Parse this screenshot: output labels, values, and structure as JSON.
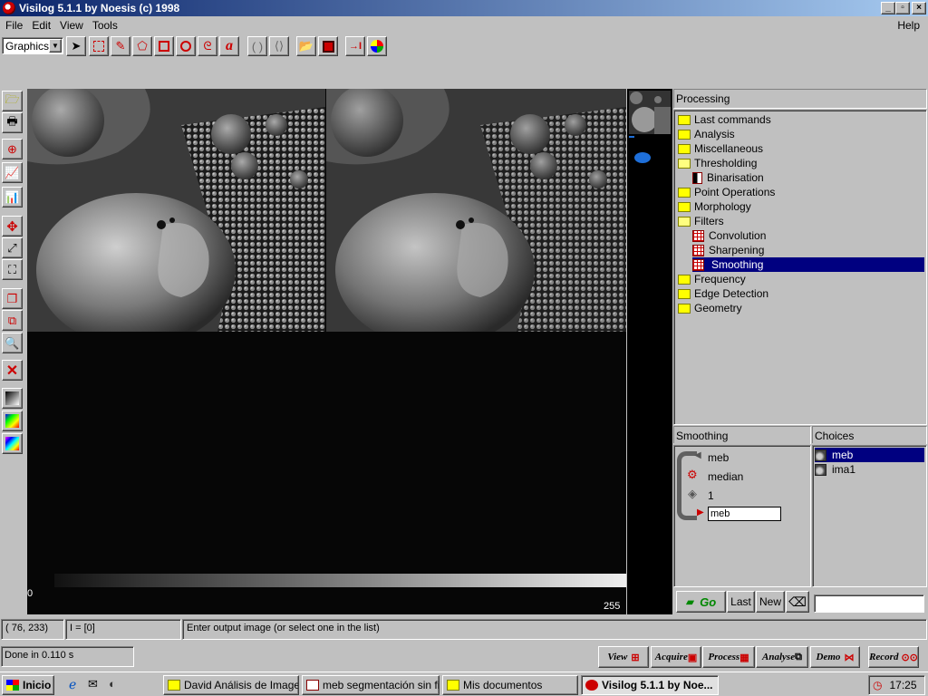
{
  "window": {
    "title": "Visilog 5.1.1 by Noesis (c) 1998"
  },
  "menu": {
    "file": "File",
    "edit": "Edit",
    "view": "View",
    "tools": "Tools",
    "help": "Help"
  },
  "toolbar": {
    "mode_select": "Graphics"
  },
  "image": {
    "scale_min": "0",
    "scale_max": "255"
  },
  "processing": {
    "header": "Processing",
    "tree": [
      {
        "label": "Last commands",
        "type": "folder"
      },
      {
        "label": "Analysis",
        "type": "folder"
      },
      {
        "label": "Miscellaneous",
        "type": "folder"
      },
      {
        "label": "Thresholding",
        "type": "folder-open"
      },
      {
        "label": "Binarisation",
        "type": "bin",
        "indent": 1
      },
      {
        "label": "Point Operations",
        "type": "folder"
      },
      {
        "label": "Morphology",
        "type": "folder"
      },
      {
        "label": "Filters",
        "type": "folder-open"
      },
      {
        "label": "Convolution",
        "type": "grid",
        "indent": 1
      },
      {
        "label": "Sharpening",
        "type": "grid",
        "indent": 1
      },
      {
        "label": "Smoothing",
        "type": "grid",
        "indent": 1,
        "selected": true
      },
      {
        "label": "Frequency",
        "type": "folder"
      },
      {
        "label": "Edge Detection",
        "type": "folder"
      },
      {
        "label": "Geometry",
        "type": "folder"
      }
    ]
  },
  "smoothing": {
    "header": "Smoothing",
    "input_image": "meb",
    "method": "median",
    "size": "1",
    "output_image": "meb"
  },
  "choices": {
    "header": "Choices",
    "items": [
      {
        "label": "meb",
        "selected": true
      },
      {
        "label": "ima1",
        "selected": false
      }
    ]
  },
  "command_buttons": {
    "go": "Go",
    "last": "Last",
    "new": "New"
  },
  "status": {
    "coords": "( 76, 233)",
    "intensity": "I = [0]",
    "message": "Enter output image (or select one in the list)",
    "done": "Done in 0.110 s"
  },
  "actions": {
    "view": "View",
    "acquire": "Acquire",
    "process": "Process",
    "analyse": "Analyse",
    "demo": "Demo",
    "record": "Record"
  },
  "taskbar": {
    "start": "Inicio",
    "tasks": [
      "David Análisis de Imagen",
      "meb segmentación sin filt...",
      "Mis documentos",
      "Visilog 5.1.1 by Noe..."
    ],
    "clock": "17:25"
  },
  "colors": {
    "titlebar": "#0a246a",
    "selection": "#000080",
    "face": "#c0c0c0",
    "folder": "#ffff00"
  }
}
